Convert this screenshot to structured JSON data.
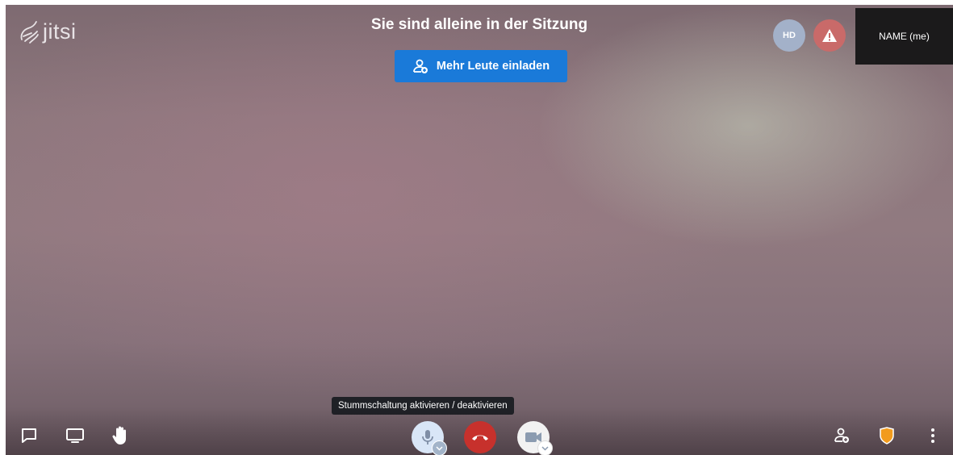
{
  "app": {
    "logo_text": "jitsi"
  },
  "header": {
    "title": "Sie sind alleine in der Sitzung"
  },
  "invite_button": {
    "label": "Mehr Leute einladen"
  },
  "indicators": {
    "quality_label": "HD"
  },
  "local_video": {
    "name": "NAME (me)"
  },
  "tooltip": {
    "text": "Stummschaltung aktivieren / deaktivieren"
  },
  "colors": {
    "accent": "#1a7ad9",
    "hangup": "#c7312c",
    "warning": "#c96a69",
    "security": "#f29b1d"
  },
  "toolbar": {
    "left_icons": [
      "chat-icon",
      "screen-share-icon",
      "raise-hand-icon"
    ],
    "center_icons": [
      "microphone-icon",
      "hangup-icon",
      "camera-icon"
    ],
    "right_icons": [
      "invite-icon",
      "security-shield-icon",
      "more-icon"
    ]
  }
}
